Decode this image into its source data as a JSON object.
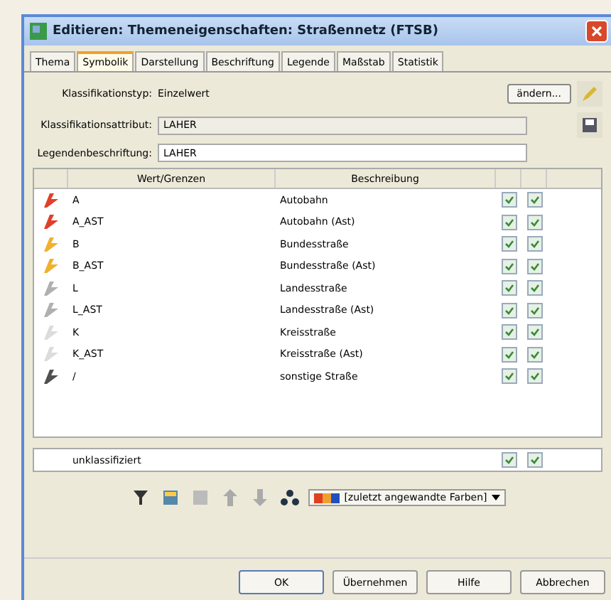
{
  "window": {
    "title": "Editieren: Themeneigenschaften: Straßennetz (FTSB)"
  },
  "tabs": [
    {
      "label": "Thema",
      "selected": false
    },
    {
      "label": "Symbolik",
      "selected": true
    },
    {
      "label": "Darstellung",
      "selected": false
    },
    {
      "label": "Beschriftung",
      "selected": false
    },
    {
      "label": "Legende",
      "selected": false
    },
    {
      "label": "Maßstab",
      "selected": false
    },
    {
      "label": "Statistik",
      "selected": false
    }
  ],
  "classification": {
    "type_label": "Klassifikationstyp:",
    "type_value": "Einzelwert",
    "change_button": "ändern...",
    "attribute_label": "Klassifikationsattribut:",
    "attribute_value": "LAHER",
    "legend_label": "Legendenbeschriftung:",
    "legend_value": "LAHER"
  },
  "table": {
    "columns": [
      "Wert/Grenzen",
      "Beschreibung"
    ],
    "rows": [
      {
        "value": "A",
        "description": "Autobahn",
        "color": "#e0402a",
        "checked_1": true,
        "checked_2": true
      },
      {
        "value": "A_AST",
        "description": "Autobahn (Ast)",
        "color": "#e0402a",
        "checked_1": true,
        "checked_2": true
      },
      {
        "value": "B",
        "description": "Bundesstraße",
        "color": "#f0b030",
        "checked_1": true,
        "checked_2": true
      },
      {
        "value": "B_AST",
        "description": "Bundesstraße (Ast)",
        "color": "#f0b030",
        "checked_1": true,
        "checked_2": true
      },
      {
        "value": "L",
        "description": "Landesstraße",
        "color": "#b0b0b0",
        "checked_1": true,
        "checked_2": true
      },
      {
        "value": "L_AST",
        "description": "Landesstraße (Ast)",
        "color": "#b0b0b0",
        "checked_1": true,
        "checked_2": true
      },
      {
        "value": "K",
        "description": "Kreisstraße",
        "color": "#dcdcdc",
        "checked_1": true,
        "checked_2": true
      },
      {
        "value": "K_AST",
        "description": "Kreisstraße (Ast)",
        "color": "#dcdcdc",
        "checked_1": true,
        "checked_2": true
      },
      {
        "value": "/",
        "description": "sonstige Straße",
        "color": "#505050",
        "checked_1": true,
        "checked_2": true
      }
    ]
  },
  "unclassified": {
    "label": "unklassifiziert",
    "checked_1": true,
    "checked_2": true
  },
  "palette": {
    "label": "[zuletzt angewandte Farben]"
  },
  "buttons": [
    "OK",
    "Übernehmen",
    "Hilfe",
    "Abbrechen"
  ]
}
